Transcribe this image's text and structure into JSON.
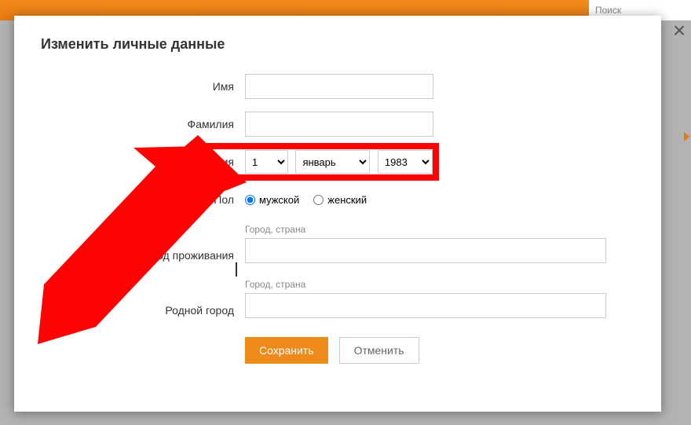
{
  "topbar": {
    "search_placeholder": "Поиск"
  },
  "modal": {
    "title": "Изменить личные данные",
    "labels": {
      "name": "Имя",
      "surname": "Фамилия",
      "dob": "Дата рождения",
      "gender": "Пол",
      "residence": "Город проживания",
      "hometown": "Родной город"
    },
    "dob": {
      "day": "1",
      "month": "январь",
      "year": "1983"
    },
    "gender": {
      "male": "мужской",
      "female": "женский",
      "selected": "male"
    },
    "location_caption": "Город, страна",
    "buttons": {
      "save": "Сохранить",
      "cancel": "Отменить"
    }
  }
}
